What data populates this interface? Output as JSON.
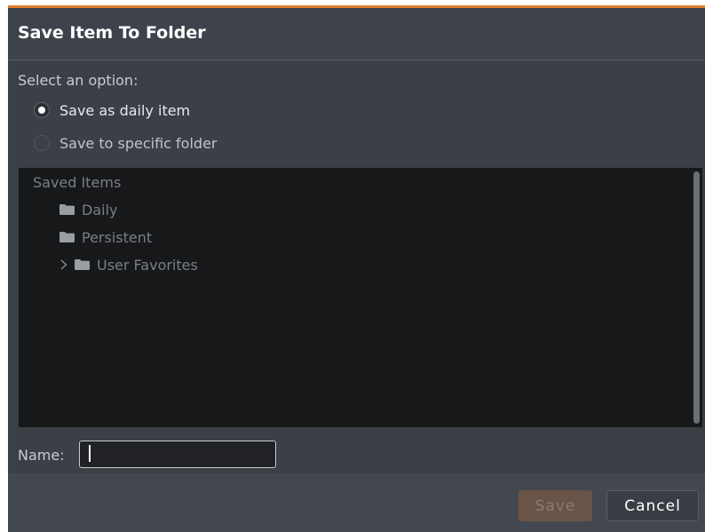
{
  "dialog": {
    "title": "Save Item To Folder",
    "accent_color": "#e07f2e"
  },
  "options": {
    "prompt": "Select an option:",
    "items": [
      {
        "label": "Save as daily item",
        "selected": true,
        "color": "#e8eaec"
      },
      {
        "label": "Save to specific folder",
        "selected": false,
        "color": "#c0c3c7"
      }
    ]
  },
  "tree": {
    "root": "Saved Items",
    "folders": [
      {
        "label": "Daily",
        "expandable": false,
        "icon": "folder-icon"
      },
      {
        "label": "Persistent",
        "expandable": false,
        "icon": "folder-icon"
      },
      {
        "label": "User Favorites",
        "expandable": true,
        "icon": "folder-icon"
      }
    ]
  },
  "name_field": {
    "label": "Name:",
    "value": "",
    "placeholder": ""
  },
  "buttons": {
    "save_label": "Save",
    "save_enabled": false,
    "cancel_label": "Cancel"
  }
}
